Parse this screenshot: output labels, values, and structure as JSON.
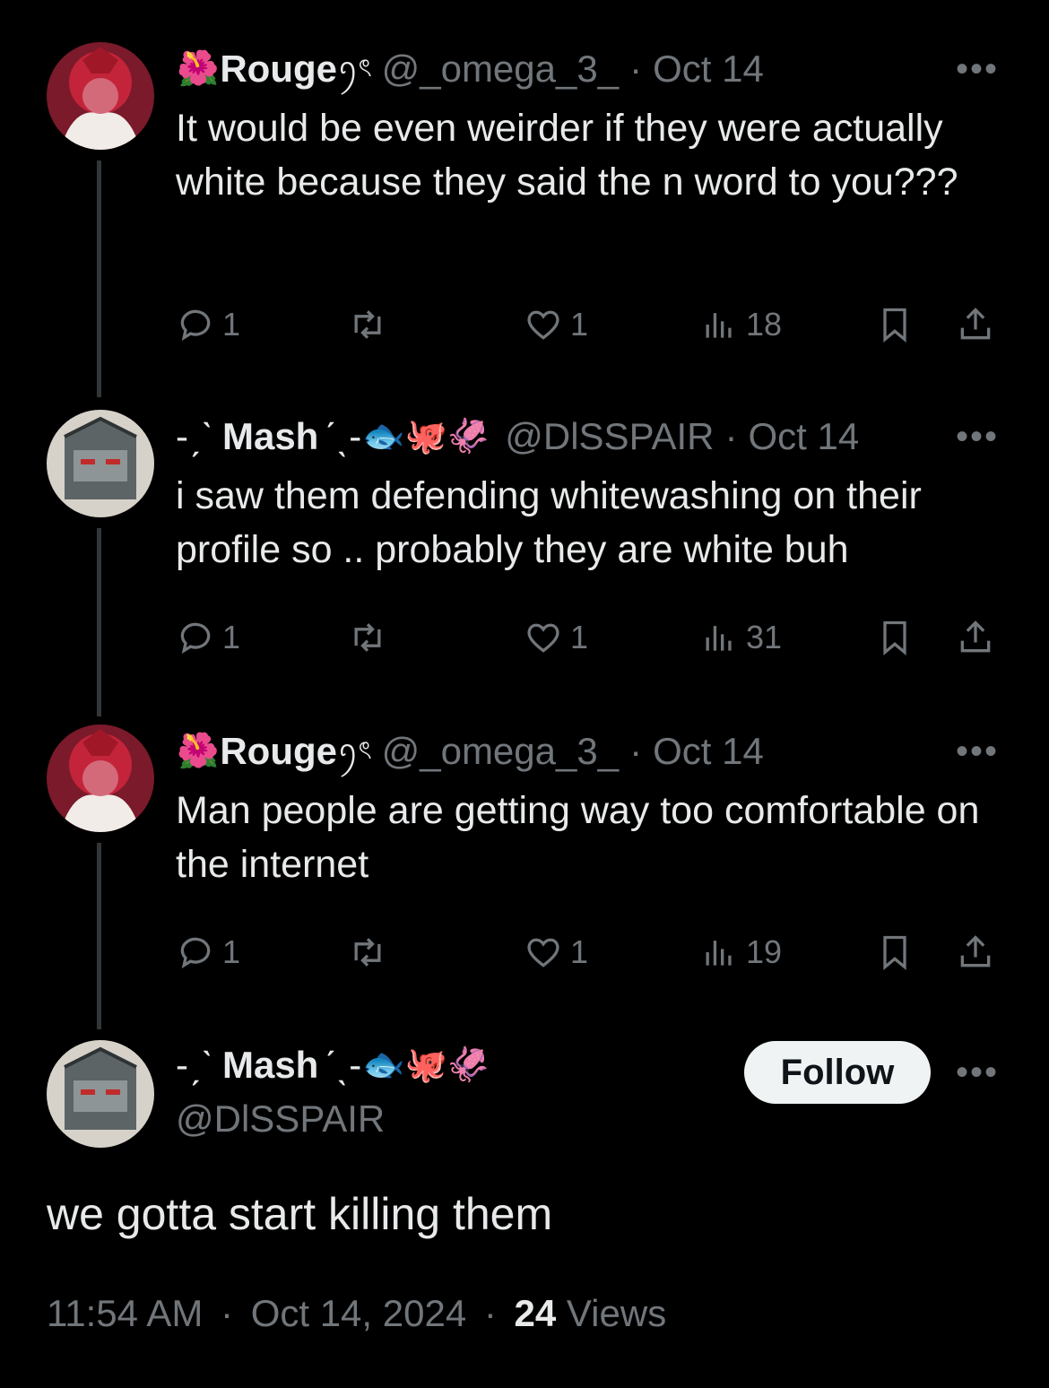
{
  "tweets": [
    {
      "name": "Rouge",
      "name_prefix_emoji": "🌺",
      "name_suffix": "ꪆৎ",
      "handle": "@_omega_3_",
      "dot": "·",
      "date": "Oct 14",
      "text": "It would be even weirder if they were actually white because they said the n word to you???",
      "replies": "1",
      "likes": "1",
      "views": "18"
    },
    {
      "name_pre": "-ˏˋ",
      "name": "Mash",
      "name_suffix": "ˊˎ-",
      "emojis": "🐟🐙🦑",
      "handle": "@DlSSPAIR",
      "dot": "·",
      "date": "Oct 14",
      "text": "i saw them defending whitewashing on their profile so .. probably they are white buh",
      "replies": "1",
      "likes": "1",
      "views": "31"
    },
    {
      "name": "Rouge",
      "name_prefix_emoji": "🌺",
      "name_suffix": "ꪆৎ",
      "handle": "@_omega_3_",
      "dot": "·",
      "date": "Oct 14",
      "text": "Man people are getting way too comfortable on the internet",
      "replies": "1",
      "likes": "1",
      "views": "19"
    }
  ],
  "main": {
    "name_pre": "-ˏˋ",
    "name": "Mash",
    "name_suffix": "ˊˎ-",
    "emojis": "🐟🐙🦑",
    "handle": "@DlSSPAIR",
    "follow_label": "Follow",
    "text": "we gotta start killing them",
    "time": "11:54 AM",
    "dot": "·",
    "date": "Oct 14, 2024",
    "views_count": "24",
    "views_label": "Views"
  },
  "more_label": "•••",
  "colors": {
    "background": "#000000",
    "text": "#e7e9ea",
    "muted": "#71767b",
    "follow_bg": "#eff3f4"
  }
}
